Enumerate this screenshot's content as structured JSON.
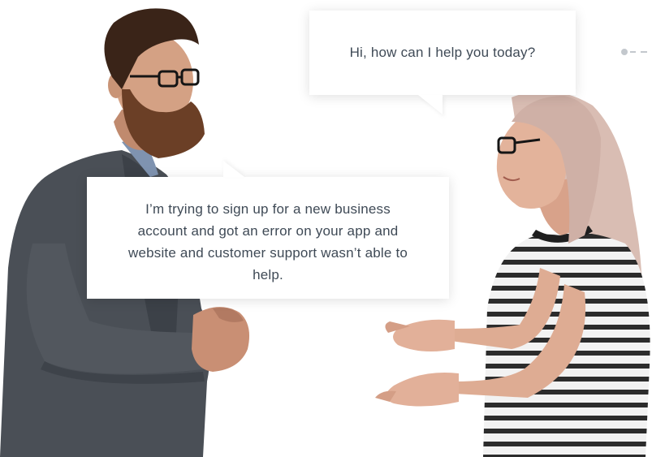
{
  "conversation": {
    "agent_message": "Hi, how can I help you today?",
    "customer_message": "I’m trying to sign up for a new business account and got an error on your app and website and customer support wasn’t able to help."
  },
  "colors": {
    "background": "#ffffff",
    "bubble": "#ffffff",
    "text": "#3f4a56",
    "pager": "#c3c8cd",
    "jacket": "#4a4f56",
    "hair_woman": "#d9bdb3",
    "beard": "#6b3f26"
  },
  "pager": {
    "active_index": 0
  }
}
